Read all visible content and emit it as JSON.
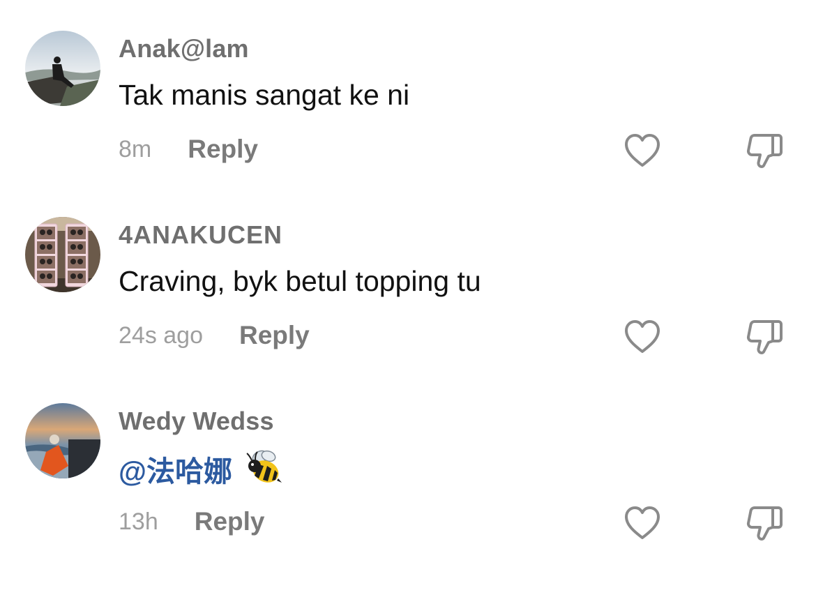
{
  "comments": [
    {
      "username": "Anak@lam",
      "text": "Tak manis sangat ke ni",
      "time": "8m",
      "reply_label": "Reply"
    },
    {
      "username": "4ANAKUCEN",
      "text": "Craving, byk betul topping tu",
      "time": "24s ago",
      "reply_label": "Reply"
    },
    {
      "username": "Wedy Wedss",
      "mention": "@法哈娜",
      "emoji_icon": "bee-emoji",
      "time": "13h",
      "reply_label": "Reply"
    }
  ],
  "icons": {
    "like": "heart-outline-icon",
    "dislike": "thumbs-down-outline-icon"
  },
  "colors": {
    "username": "#6f6f6f",
    "comment_text": "#111111",
    "mention": "#2c5aa0",
    "meta": "#9e9e9e",
    "reply": "#7a7a7a",
    "icon_stroke": "#8a8a8a"
  }
}
